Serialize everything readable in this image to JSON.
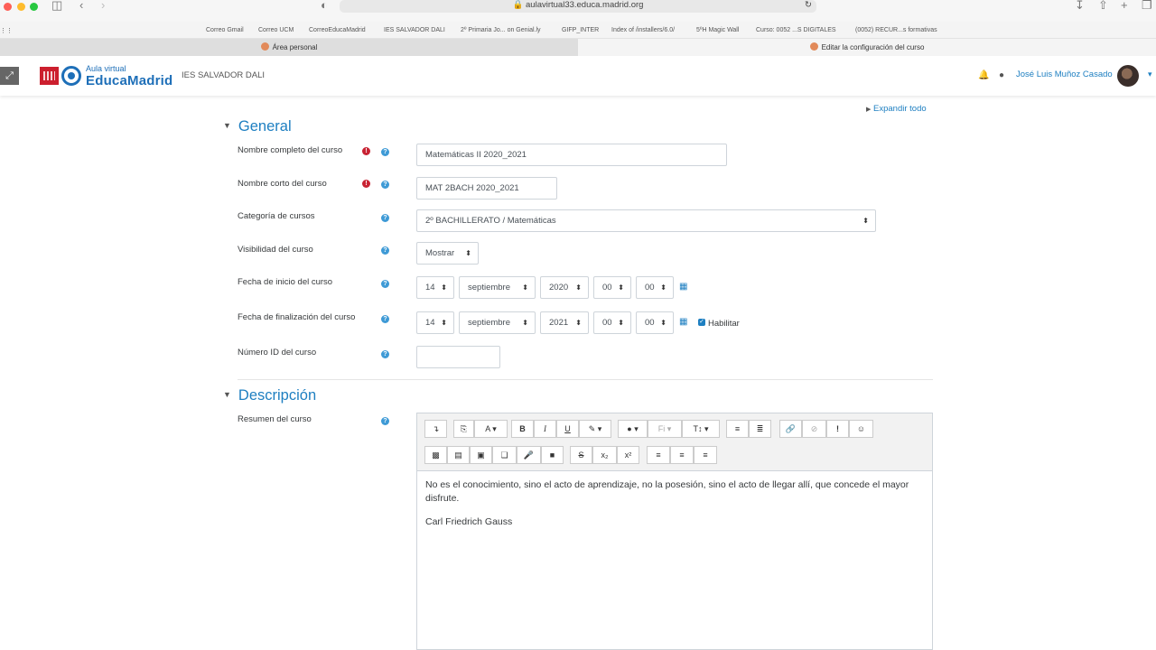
{
  "browser": {
    "url": "aulavirtual33.educa.madrid.org",
    "bookmarks": [
      "Correo Gmail",
      "Correo UCM",
      "CorreoEducaMadrid",
      "IES SALVADOR DALI",
      "2º Primaria Jo... on Genial.ly",
      "GIFP_INTER",
      "Index of /installers/6.0/",
      "5ºH Magic Wall",
      "Curso: 0052 ...S DIGITALES",
      "(0052) RECUR...s formativas"
    ],
    "tabs": [
      "Área personal",
      "Editar la configuración del curso"
    ]
  },
  "header": {
    "logo_small": "Aula virtual",
    "logo_big": "EducaMadrid",
    "school": "IES SALVADOR DALI",
    "user_name": "José Luis Muñoz Casado"
  },
  "form": {
    "expand_all": "Expandir todo",
    "section_general": "General",
    "fullname_label": "Nombre completo del curso",
    "fullname_value": "Matemáticas II 2020_2021",
    "shortname_label": "Nombre corto del curso",
    "shortname_value": "MAT 2BACH 2020_2021",
    "category_label": "Categoría de cursos",
    "category_value": "2º BACHILLERATO / Matemáticas",
    "visibility_label": "Visibilidad del curso",
    "visibility_value": "Mostrar",
    "startdate_label": "Fecha de inicio del curso",
    "start": {
      "day": "14",
      "month": "septiembre",
      "year": "2020",
      "hour": "00",
      "minute": "00"
    },
    "enddate_label": "Fecha de finalización del curso",
    "end": {
      "day": "14",
      "month": "septiembre",
      "year": "2021",
      "hour": "00",
      "minute": "00"
    },
    "enable_label": "Habilitar",
    "idnumber_label": "Número ID del curso",
    "idnumber_value": "",
    "section_description": "Descripción",
    "summary_label": "Resumen del curso",
    "summary_paragraph1": "No es el conocimiento, sino el acto de aprendizaje, no la posesión, sino el acto de llegar allí, que concede el mayor disfrute.",
    "summary_paragraph2": "Carl Friedrich Gauss"
  },
  "colors": {
    "accent": "#1e7fc1",
    "required": "#c82333",
    "brand_red": "#cc1f2e"
  }
}
